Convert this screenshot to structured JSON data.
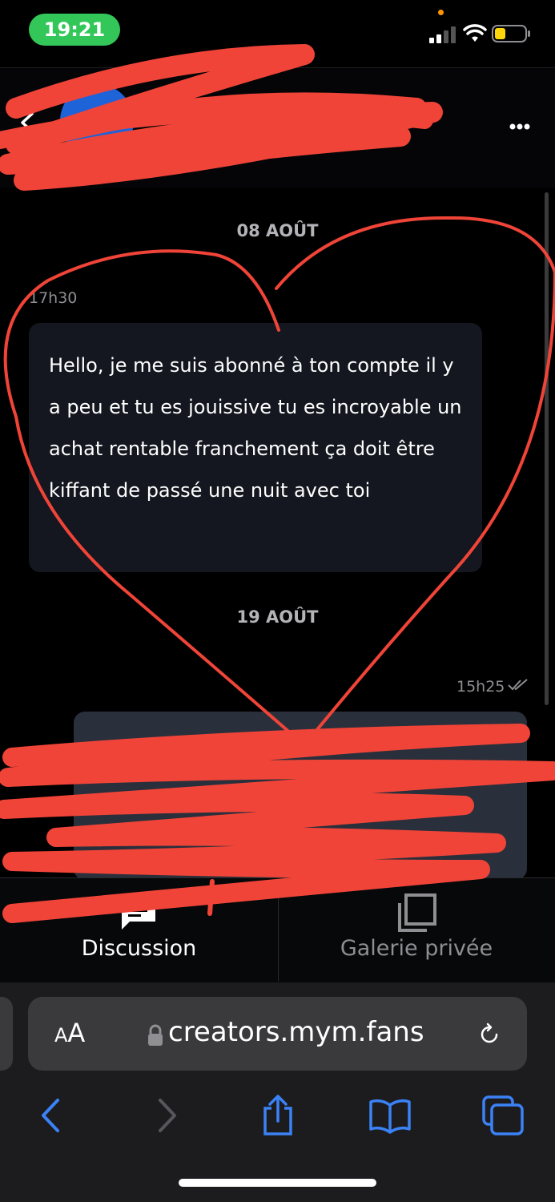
{
  "status_bar": {
    "time": "19:21"
  },
  "chat": {
    "header_name": "",
    "header_sub": "",
    "date_1": "08 AOÛT",
    "time_1": "17h30",
    "message_in": "Hello, je me suis abonné à ton compte il y a peu et tu es jouissive tu es incroyable un achat rentable franchement ça doit être kiffant de passé une nuit avec toi",
    "date_2": "19 AOÛT",
    "time_2": "15h25",
    "message_out": ""
  },
  "tabs": {
    "discussion": "Discussion",
    "gallery": "Galerie privée"
  },
  "browser": {
    "aa_small": "A",
    "aa_big": "A",
    "url": "creators.mym.fans",
    "accent_color": "#3b82f6"
  },
  "icons": [
    "back-arrow-icon",
    "more-icon",
    "double-check-icon",
    "chat-icon",
    "gallery-icon",
    "lock-icon",
    "reload-icon",
    "back-icon",
    "forward-icon",
    "share-icon",
    "bookmarks-icon",
    "tabs-icon"
  ]
}
